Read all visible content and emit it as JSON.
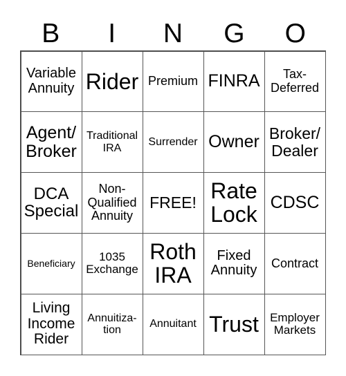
{
  "header": {
    "letters": [
      "B",
      "I",
      "N",
      "G",
      "O"
    ]
  },
  "cells": [
    {
      "text": "Variable\nAnnuity",
      "size": 20
    },
    {
      "text": "Rider",
      "size": 32
    },
    {
      "text": "Premium",
      "size": 18
    },
    {
      "text": "FINRA",
      "size": 25
    },
    {
      "text": "Tax-\nDeferred",
      "size": 18
    },
    {
      "text": "Agent/\nBroker",
      "size": 25
    },
    {
      "text": "Traditional\nIRA",
      "size": 16
    },
    {
      "text": "Surrender",
      "size": 16
    },
    {
      "text": "Owner",
      "size": 25
    },
    {
      "text": "Broker/\nDealer",
      "size": 23
    },
    {
      "text": "DCA\nSpecial",
      "size": 24
    },
    {
      "text": "Non-\nQualified\nAnnuity",
      "size": 18
    },
    {
      "text": "FREE!",
      "size": 23
    },
    {
      "text": "Rate\nLock",
      "size": 32
    },
    {
      "text": "CDSC",
      "size": 25
    },
    {
      "text": "Beneficiary",
      "size": 14
    },
    {
      "text": "1035\nExchange",
      "size": 17
    },
    {
      "text": "Roth\nIRA",
      "size": 32
    },
    {
      "text": "Fixed\nAnnuity",
      "size": 20
    },
    {
      "text": "Contract",
      "size": 18
    },
    {
      "text": "Living\nIncome\nRider",
      "size": 21
    },
    {
      "text": "Annuitiza-\ntion",
      "size": 16
    },
    {
      "text": "Annuitant",
      "size": 16
    },
    {
      "text": "Trust",
      "size": 32
    },
    {
      "text": "Employer\nMarkets",
      "size": 17
    }
  ]
}
